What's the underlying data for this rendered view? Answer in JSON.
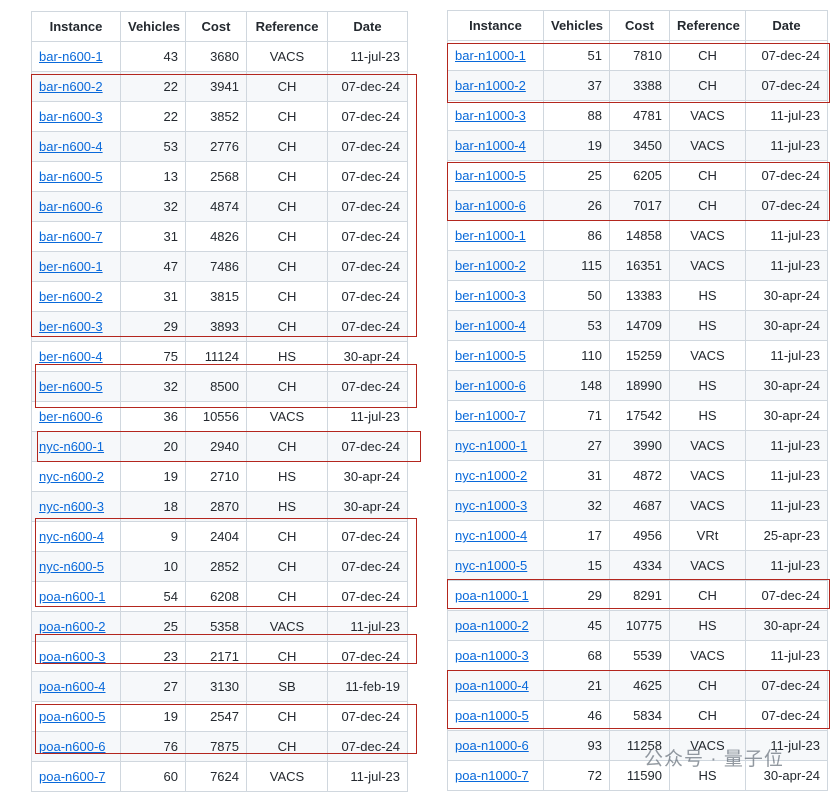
{
  "headers": [
    "Instance",
    "Vehicles",
    "Cost",
    "Reference",
    "Date"
  ],
  "left_table": [
    [
      "bar-n600-1",
      "43",
      "3680",
      "VACS",
      "11-jul-23"
    ],
    [
      "bar-n600-2",
      "22",
      "3941",
      "CH",
      "07-dec-24"
    ],
    [
      "bar-n600-3",
      "22",
      "3852",
      "CH",
      "07-dec-24"
    ],
    [
      "bar-n600-4",
      "53",
      "2776",
      "CH",
      "07-dec-24"
    ],
    [
      "bar-n600-5",
      "13",
      "2568",
      "CH",
      "07-dec-24"
    ],
    [
      "bar-n600-6",
      "32",
      "4874",
      "CH",
      "07-dec-24"
    ],
    [
      "bar-n600-7",
      "31",
      "4826",
      "CH",
      "07-dec-24"
    ],
    [
      "ber-n600-1",
      "47",
      "7486",
      "CH",
      "07-dec-24"
    ],
    [
      "ber-n600-2",
      "31",
      "3815",
      "CH",
      "07-dec-24"
    ],
    [
      "ber-n600-3",
      "29",
      "3893",
      "CH",
      "07-dec-24"
    ],
    [
      "ber-n600-4",
      "75",
      "11124",
      "HS",
      "30-apr-24"
    ],
    [
      "ber-n600-5",
      "32",
      "8500",
      "CH",
      "07-dec-24"
    ],
    [
      "ber-n600-6",
      "36",
      "10556",
      "VACS",
      "11-jul-23"
    ],
    [
      "nyc-n600-1",
      "20",
      "2940",
      "CH",
      "07-dec-24"
    ],
    [
      "nyc-n600-2",
      "19",
      "2710",
      "HS",
      "30-apr-24"
    ],
    [
      "nyc-n600-3",
      "18",
      "2870",
      "HS",
      "30-apr-24"
    ],
    [
      "nyc-n600-4",
      "9",
      "2404",
      "CH",
      "07-dec-24"
    ],
    [
      "nyc-n600-5",
      "10",
      "2852",
      "CH",
      "07-dec-24"
    ],
    [
      "poa-n600-1",
      "54",
      "6208",
      "CH",
      "07-dec-24"
    ],
    [
      "poa-n600-2",
      "25",
      "5358",
      "VACS",
      "11-jul-23"
    ],
    [
      "poa-n600-3",
      "23",
      "2171",
      "CH",
      "07-dec-24"
    ],
    [
      "poa-n600-4",
      "27",
      "3130",
      "SB",
      "11-feb-19"
    ],
    [
      "poa-n600-5",
      "19",
      "2547",
      "CH",
      "07-dec-24"
    ],
    [
      "poa-n600-6",
      "76",
      "7875",
      "CH",
      "07-dec-24"
    ],
    [
      "poa-n600-7",
      "60",
      "7624",
      "VACS",
      "11-jul-23"
    ]
  ],
  "right_table": [
    [
      "bar-n1000-1",
      "51",
      "7810",
      "CH",
      "07-dec-24"
    ],
    [
      "bar-n1000-2",
      "37",
      "3388",
      "CH",
      "07-dec-24"
    ],
    [
      "bar-n1000-3",
      "88",
      "4781",
      "VACS",
      "11-jul-23"
    ],
    [
      "bar-n1000-4",
      "19",
      "3450",
      "VACS",
      "11-jul-23"
    ],
    [
      "bar-n1000-5",
      "25",
      "6205",
      "CH",
      "07-dec-24"
    ],
    [
      "bar-n1000-6",
      "26",
      "7017",
      "CH",
      "07-dec-24"
    ],
    [
      "ber-n1000-1",
      "86",
      "14858",
      "VACS",
      "11-jul-23"
    ],
    [
      "ber-n1000-2",
      "115",
      "16351",
      "VACS",
      "11-jul-23"
    ],
    [
      "ber-n1000-3",
      "50",
      "13383",
      "HS",
      "30-apr-24"
    ],
    [
      "ber-n1000-4",
      "53",
      "14709",
      "HS",
      "30-apr-24"
    ],
    [
      "ber-n1000-5",
      "110",
      "15259",
      "VACS",
      "11-jul-23"
    ],
    [
      "ber-n1000-6",
      "148",
      "18990",
      "HS",
      "30-apr-24"
    ],
    [
      "ber-n1000-7",
      "71",
      "17542",
      "HS",
      "30-apr-24"
    ],
    [
      "nyc-n1000-1",
      "27",
      "3990",
      "VACS",
      "11-jul-23"
    ],
    [
      "nyc-n1000-2",
      "31",
      "4872",
      "VACS",
      "11-jul-23"
    ],
    [
      "nyc-n1000-3",
      "32",
      "4687",
      "VACS",
      "11-jul-23"
    ],
    [
      "nyc-n1000-4",
      "17",
      "4956",
      "VRt",
      "25-apr-23"
    ],
    [
      "nyc-n1000-5",
      "15",
      "4334",
      "VACS",
      "11-jul-23"
    ],
    [
      "poa-n1000-1",
      "29",
      "8291",
      "CH",
      "07-dec-24"
    ],
    [
      "poa-n1000-2",
      "45",
      "10775",
      "HS",
      "30-apr-24"
    ],
    [
      "poa-n1000-3",
      "68",
      "5539",
      "VACS",
      "11-jul-23"
    ],
    [
      "poa-n1000-4",
      "21",
      "4625",
      "CH",
      "07-dec-24"
    ],
    [
      "poa-n1000-5",
      "46",
      "5834",
      "CH",
      "07-dec-24"
    ],
    [
      "poa-n1000-6",
      "93",
      "11258",
      "VACS",
      "11-jul-23"
    ],
    [
      "poa-n1000-7",
      "72",
      "11590",
      "HS",
      "30-apr-24"
    ]
  ],
  "watermark": "公众号 · 量子位",
  "highlight_color": "#b3261e"
}
